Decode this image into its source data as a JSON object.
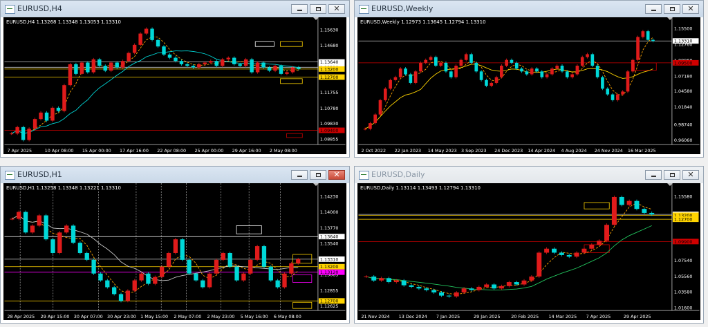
{
  "colors": {
    "bull": "#e01b1b",
    "bear": "#00d8d8",
    "yellow": "#ffd400",
    "magenta": "#ff00ff",
    "cyan": "#00d8d8",
    "gray": "#c8c8c8",
    "red": "#d00000",
    "white": "#ffffff",
    "orange": "#ffa500"
  },
  "windows": [
    {
      "title": "EURUSD,H4",
      "ohlc": "EURUSD,H4  1.13268 1.13348 1.13053 1.13310",
      "close_highlight": false,
      "yticks": [
        "1.15630",
        "1.14680",
        "1.13640",
        "1.13200",
        "1.12700",
        "1.11755",
        "1.10780",
        "1.09830",
        "1.08855"
      ],
      "xticks": [
        "7 Apr 2025",
        "10 Apr 08:00",
        "15 Apr 00:00",
        "17 Apr 16:00",
        "22 Apr 08:00",
        "25 Apr 00:00",
        "29 Apr 16:00",
        "2 May 08:00"
      ],
      "ymin": 1.086,
      "ymax": 1.159,
      "price": [
        1.092,
        1.096,
        1.088,
        1.095,
        1.101,
        1.105,
        1.1,
        1.108,
        1.106,
        1.122,
        1.135,
        1.129,
        1.136,
        1.13,
        1.138,
        1.134,
        1.131,
        1.136,
        1.133,
        1.137,
        1.142,
        1.147,
        1.154,
        1.157,
        1.15,
        1.146,
        1.141,
        1.139,
        1.137,
        1.135,
        1.134,
        1.133,
        1.135,
        1.136,
        1.137,
        1.134,
        1.138,
        1.139,
        1.135,
        1.134,
        1.138,
        1.13,
        1.136,
        1.133,
        1.131,
        1.134,
        1.129,
        1.13,
        1.133,
        1.132
      ],
      "hlines": [
        {
          "v": 1.1364,
          "color": "#c8c8c8",
          "label": "1.13640"
        },
        {
          "v": 1.1331,
          "color": "#c8c8c8",
          "label": "1.13310"
        },
        {
          "v": 1.132,
          "color": "#ffd400",
          "label": "1.13200"
        },
        {
          "v": 1.127,
          "color": "#ffd400",
          "label": "1.12700"
        },
        {
          "v": 1.094,
          "color": "#d00000",
          "label": "1.09400"
        }
      ],
      "boxes": [
        {
          "x0": 0.8,
          "x1": 0.86,
          "v0": 1.149,
          "v1": 1.146,
          "color": "#ffffff"
        },
        {
          "x0": 0.88,
          "x1": 0.95,
          "v0": 1.149,
          "v1": 1.146,
          "color": "#ffd400"
        },
        {
          "x0": 0.88,
          "x1": 0.95,
          "v0": 1.126,
          "v1": 1.123,
          "color": "#ffd400"
        },
        {
          "x0": 0.9,
          "x1": 0.95,
          "v0": 1.092,
          "v1": 1.0895,
          "color": "#d00000"
        }
      ],
      "vlines": [],
      "ma": [
        "#ffa500",
        "#00d8d8"
      ]
    },
    {
      "title": "EURUSD,Weekly",
      "ohlc": "EURUSD,Weekly  1.12973 1.13645 1.12794 1.13310",
      "close_highlight": false,
      "yticks": [
        "1.15500",
        "1.13310",
        "1.12760",
        "1.09960",
        "1.07180",
        "1.04580",
        "1.01840",
        "0.98740",
        "0.96060"
      ],
      "xticks": [
        "2 Oct 2022",
        "22 Jan 2023",
        "14 May 2023",
        "3 Sep 2023",
        "24 Dec 2023",
        "14 Apr 2024",
        "4 Aug 2024",
        "24 Nov 2024",
        "16 Mar 2025"
      ],
      "ymin": 0.955,
      "ymax": 1.16,
      "price": [
        0.98,
        0.99,
        1.005,
        1.03,
        1.05,
        1.065,
        1.07,
        1.085,
        1.075,
        1.06,
        1.08,
        1.095,
        1.1,
        1.105,
        1.09,
        1.095,
        1.08,
        1.07,
        1.09,
        1.1,
        1.11,
        1.095,
        1.08,
        1.065,
        1.055,
        1.06,
        1.07,
        1.09,
        1.1,
        1.095,
        1.085,
        1.08,
        1.075,
        1.085,
        1.08,
        1.07,
        1.075,
        1.085,
        1.09,
        1.08,
        1.07,
        1.075,
        1.09,
        1.105,
        1.11,
        1.09,
        1.07,
        1.05,
        1.04,
        1.03,
        1.04,
        1.045,
        1.08,
        1.1,
        1.14,
        1.15,
        1.135,
        1.1331
      ],
      "hlines": [
        {
          "v": 1.1331,
          "color": "#c8c8c8",
          "label": "1.13310"
        },
        {
          "v": 1.095,
          "color": "#d00000",
          "label": "1.09500"
        }
      ],
      "boxes": [
        {
          "x0": 0.88,
          "x1": 0.95,
          "v0": 1.095,
          "v1": 1.082,
          "color": "#d00000"
        }
      ],
      "vlines": [],
      "ma": [
        "#ffa500",
        "#ffd400"
      ]
    },
    {
      "title": "EURUSD,H1",
      "ohlc": "EURUSD,H1  1.13258 1.13348 1.13221 1.13310",
      "close_highlight": true,
      "yticks": [
        "1.14230",
        "1.14000",
        "1.13770",
        "1.13640",
        "1.13540",
        "1.13310",
        "1.13200",
        "1.13085",
        "1.12855",
        "1.12700",
        "1.12625"
      ],
      "xticks": [
        "28 Apr 2025",
        "29 Apr 15:00",
        "30 Apr 07:00",
        "30 Apr 23:00",
        "1 May 15:00",
        "2 May 07:00",
        "2 May 23:00",
        "5 May 16:00",
        "6 May 08:00"
      ],
      "ymin": 1.1258,
      "ymax": 1.143,
      "price": [
        1.139,
        1.14,
        1.137,
        1.138,
        1.1395,
        1.136,
        1.134,
        1.137,
        1.138,
        1.1355,
        1.134,
        1.133,
        1.131,
        1.13,
        1.129,
        1.128,
        1.127,
        1.1285,
        1.13,
        1.131,
        1.1295,
        1.1305,
        1.132,
        1.134,
        1.136,
        1.133,
        1.131,
        1.13,
        1.129,
        1.131,
        1.133,
        1.134,
        1.132,
        1.13,
        1.131,
        1.133,
        1.135,
        1.132,
        1.13,
        1.129,
        1.131,
        1.1325,
        1.1331
      ],
      "hlines": [
        {
          "v": 1.1364,
          "color": "#ffffff",
          "label": "1.13640"
        },
        {
          "v": 1.1331,
          "color": "#c8c8c8",
          "label": "1.13310"
        },
        {
          "v": 1.132,
          "color": "#ffd400",
          "label": "1.13200"
        },
        {
          "v": 1.1312,
          "color": "#ff00ff",
          "label": "1.13120"
        },
        {
          "v": 1.127,
          "color": "#ffd400",
          "label": "1.12700"
        }
      ],
      "boxes": [
        {
          "x0": 0.74,
          "x1": 0.82,
          "v0": 1.138,
          "v1": 1.1368,
          "color": "#ffffff"
        },
        {
          "x0": 0.92,
          "x1": 0.98,
          "v0": 1.1338,
          "v1": 1.1325,
          "color": "#ffd400"
        },
        {
          "x0": 0.92,
          "x1": 0.98,
          "v0": 1.1308,
          "v1": 1.1297,
          "color": "#ff00ff"
        },
        {
          "x0": 0.92,
          "x1": 0.98,
          "v0": 1.1268,
          "v1": 1.1259,
          "color": "#ffd400"
        }
      ],
      "vlines": [
        0.05,
        0.155,
        0.3,
        0.42,
        0.5,
        0.58,
        0.69,
        0.78,
        0.88
      ],
      "ma": [
        "#ffa500",
        "#c8c8c8"
      ]
    },
    {
      "title": "EURUSD,Daily",
      "ohlc": "EURUSD,Daily  1.13114 1.13493 1.12794 1.13310",
      "close_highlight": false,
      "yticks": [
        "1.15580",
        "1.13200",
        "1.12700",
        "1.09900",
        "1.07540",
        "1.05560",
        "1.03580",
        "1.01600"
      ],
      "xticks": [
        "21 Nov 2024",
        "13 Dec 2024",
        "7 Jan 2025",
        "29 Jan 2025",
        "20 Feb 2025",
        "14 Mar 2025",
        "7 Apr 2025",
        "29 Apr 2025"
      ],
      "ymin": 1.014,
      "ymax": 1.162,
      "price": [
        1.055,
        1.05,
        1.053,
        1.048,
        1.05,
        1.044,
        1.042,
        1.04,
        1.038,
        1.035,
        1.031,
        1.03,
        1.035,
        1.04,
        1.038,
        1.042,
        1.045,
        1.04,
        1.043,
        1.048,
        1.045,
        1.05,
        1.055,
        1.085,
        1.09,
        1.085,
        1.082,
        1.08,
        1.085,
        1.09,
        1.095,
        1.1,
        1.12,
        1.155,
        1.145,
        1.15,
        1.14,
        1.135,
        1.1331
      ],
      "hlines": [
        {
          "v": 1.1331,
          "color": "#c8c8c8",
          "label": "1.13310"
        },
        {
          "v": 1.132,
          "color": "#ffd400",
          "label": "1.13200"
        },
        {
          "v": 1.127,
          "color": "#ffd400",
          "label": "1.12700"
        },
        {
          "v": 1.099,
          "color": "#d00000",
          "label": "1.09900"
        }
      ],
      "boxes": [
        {
          "x0": 0.72,
          "x1": 0.8,
          "v0": 1.148,
          "v1": 1.14,
          "color": "#ffd400"
        },
        {
          "x0": 0.72,
          "x1": 0.8,
          "v0": 1.095,
          "v1": 1.085,
          "color": "#d00000"
        }
      ],
      "vlines": [],
      "ma": [
        "#ffa500",
        "#22c55e"
      ]
    }
  ]
}
